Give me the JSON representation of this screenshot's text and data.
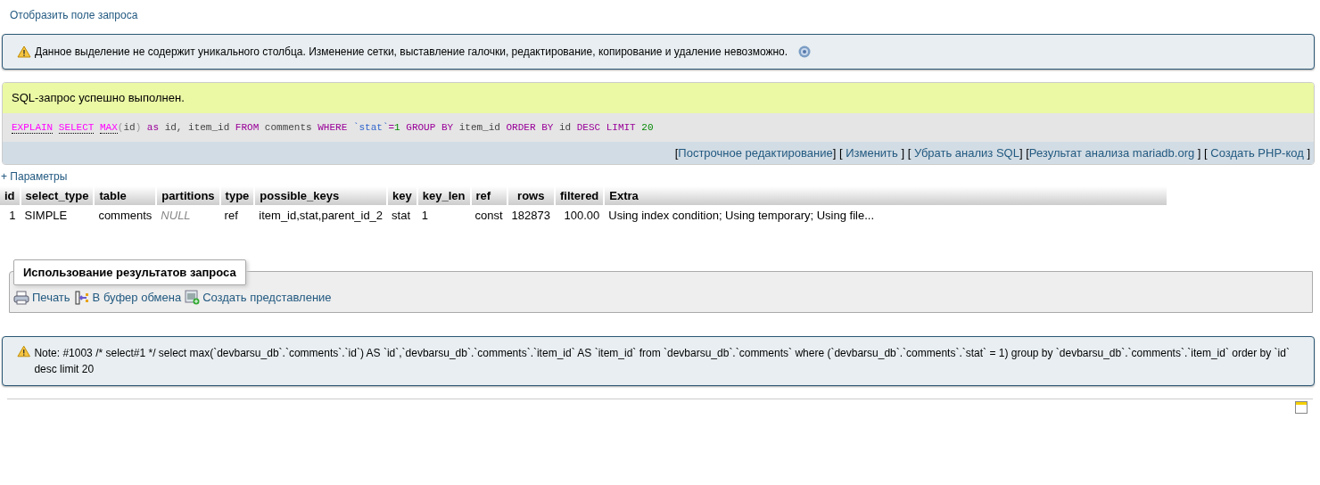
{
  "query_toggle": "Отобразить поле запроса",
  "warning": {
    "text": "Данное выделение не содержит уникального столбца. Изменение сетки, выставление галочки, редактирование, копирование и удаление невозможно."
  },
  "success": {
    "message": "SQL-запрос успешно выполнен.",
    "sql_words": [
      [
        {
          "text": "EXPLAIN",
          "kind": "link"
        }
      ],
      [
        {
          "text": "SELECT",
          "kind": "link"
        }
      ],
      [
        {
          "text": "MAX",
          "kind": "link"
        },
        {
          "text": "(",
          "kind": "paren"
        },
        {
          "text": "id",
          "kind": "plain"
        },
        {
          "text": ")",
          "kind": "paren"
        }
      ],
      [
        {
          "text": "as",
          "kind": "keyword"
        }
      ],
      [
        {
          "text": "id,",
          "kind": "plain"
        }
      ],
      [
        {
          "text": "item_id",
          "kind": "plain"
        }
      ],
      [
        {
          "text": "FROM",
          "kind": "keyword"
        }
      ],
      [
        {
          "text": "comments",
          "kind": "plain"
        }
      ],
      [
        {
          "text": "WHERE",
          "kind": "keyword"
        }
      ],
      [
        {
          "text": "`stat`",
          "kind": "name"
        },
        {
          "text": "=",
          "kind": "operator"
        },
        {
          "text": "1",
          "kind": "number"
        }
      ],
      [
        {
          "text": "GROUP",
          "kind": "keyword"
        }
      ],
      [
        {
          "text": "BY",
          "kind": "keyword"
        }
      ],
      [
        {
          "text": "item_id",
          "kind": "plain"
        }
      ],
      [
        {
          "text": "ORDER",
          "kind": "keyword"
        }
      ],
      [
        {
          "text": "BY",
          "kind": "keyword"
        }
      ],
      [
        {
          "text": "id",
          "kind": "plain"
        }
      ],
      [
        {
          "text": "DESC",
          "kind": "keyword"
        }
      ],
      [
        {
          "text": "LIMIT",
          "kind": "keyword"
        }
      ],
      [
        {
          "text": "20",
          "kind": "number"
        }
      ]
    ],
    "links": [
      {
        "before": "[",
        "label": "Построчное редактирование",
        "after": "]"
      },
      {
        "before": "[ ",
        "label": "Изменить",
        "after": " ]"
      },
      {
        "before": "[ ",
        "label": "Убрать анализ SQL",
        "after": "]"
      },
      {
        "before": "[",
        "label": "Результат анализа mariadb.org",
        "after": " ]"
      },
      {
        "before": "[ ",
        "label": "Создать PHP-код",
        "after": " ]"
      }
    ]
  },
  "options_link": "+ Параметры",
  "table": {
    "columns": [
      "id",
      "select_type",
      "table",
      "partitions",
      "type",
      "possible_keys",
      "key",
      "key_len",
      "ref",
      "rows",
      "filtered",
      "Extra"
    ],
    "rows": [
      [
        {
          "text": "1",
          "kind": "number"
        },
        {
          "text": "SIMPLE",
          "kind": "text"
        },
        {
          "text": "comments",
          "kind": "text"
        },
        {
          "text": "NULL",
          "kind": "null"
        },
        {
          "text": "ref",
          "kind": "text"
        },
        {
          "text": "item_id,stat,parent_id_2",
          "kind": "text"
        },
        {
          "text": "stat",
          "kind": "text"
        },
        {
          "text": "1",
          "kind": "text"
        },
        {
          "text": "const",
          "kind": "text"
        },
        {
          "text": "182873",
          "kind": "text"
        },
        {
          "text": "100.00",
          "kind": "number"
        },
        {
          "text": "Using index condition; Using temporary; Using file...",
          "kind": "text"
        }
      ]
    ]
  },
  "results_ops": {
    "legend": "Использование результатов запроса",
    "actions": [
      {
        "label": "Печать",
        "kind": "print"
      },
      {
        "label": "В буфер обмена",
        "kind": "clipboard"
      },
      {
        "label": "Создать представление",
        "kind": "view"
      }
    ]
  },
  "note": {
    "text": "Note: #1003 /* select#1 */ select max(`devbarsu_db`.`comments`.`id`) AS `id`,`devbarsu_db`.`comments`.`item_id` AS `item_id` from `devbarsu_db`.`comments` where (`devbarsu_db`.`comments`.`stat` = 1) group by `devbarsu_db`.`comments`.`item_id` order by `id` desc limit 20"
  }
}
